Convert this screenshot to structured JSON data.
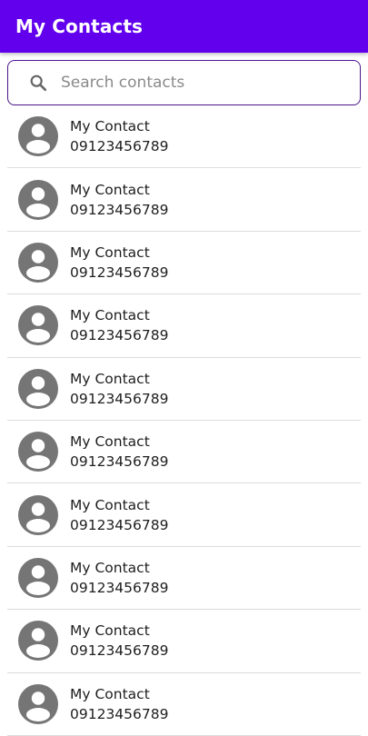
{
  "app": {
    "title": "My Contacts"
  },
  "search": {
    "placeholder": "Search contacts",
    "value": "",
    "icon": "search-icon"
  },
  "contacts": [
    {
      "name": "My Contact",
      "phone": "09123456789",
      "icon": "account-circle-icon"
    },
    {
      "name": "My Contact",
      "phone": "09123456789",
      "icon": "account-circle-icon"
    },
    {
      "name": "My Contact",
      "phone": "09123456789",
      "icon": "account-circle-icon"
    },
    {
      "name": "My Contact",
      "phone": "09123456789",
      "icon": "account-circle-icon"
    },
    {
      "name": "My Contact",
      "phone": "09123456789",
      "icon": "account-circle-icon"
    },
    {
      "name": "My Contact",
      "phone": "09123456789",
      "icon": "account-circle-icon"
    },
    {
      "name": "My Contact",
      "phone": "09123456789",
      "icon": "account-circle-icon"
    },
    {
      "name": "My Contact",
      "phone": "09123456789",
      "icon": "account-circle-icon"
    },
    {
      "name": "My Contact",
      "phone": "09123456789",
      "icon": "account-circle-icon"
    },
    {
      "name": "My Contact",
      "phone": "09123456789",
      "icon": "account-circle-icon"
    }
  ],
  "colors": {
    "primary": "#6200ee",
    "search_border": "#4a148c",
    "avatar": "#757575"
  }
}
